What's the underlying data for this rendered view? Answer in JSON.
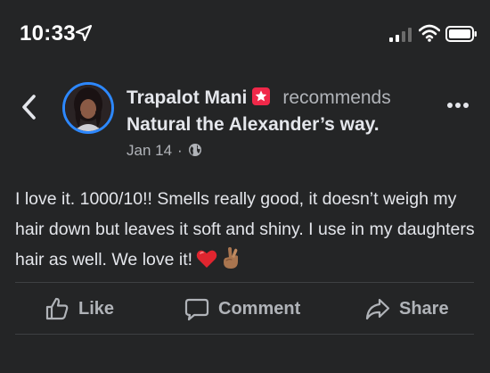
{
  "status_bar": {
    "time": "10:33"
  },
  "post": {
    "author": "Trapalot Mani",
    "action_text": "recommends",
    "page_name": "Natural the Alexander’s way.",
    "date": "Jan 14",
    "separator": "·",
    "review_text": "I love it. 1000/10!! Smells really good, it doesn’t weigh my hair down but leaves it soft and shiny. I use in my daughters hair as well. We love it!",
    "emojis": [
      "red-heart",
      "crossed-fingers"
    ]
  },
  "actions": {
    "like": "Like",
    "comment": "Comment",
    "share": "Share"
  },
  "colors": {
    "background": "#242526",
    "text": "#e4e6eb",
    "muted": "#b0b3b8",
    "accent": "#2d88ff",
    "badge": "#f02849",
    "divider": "#3e4042"
  }
}
